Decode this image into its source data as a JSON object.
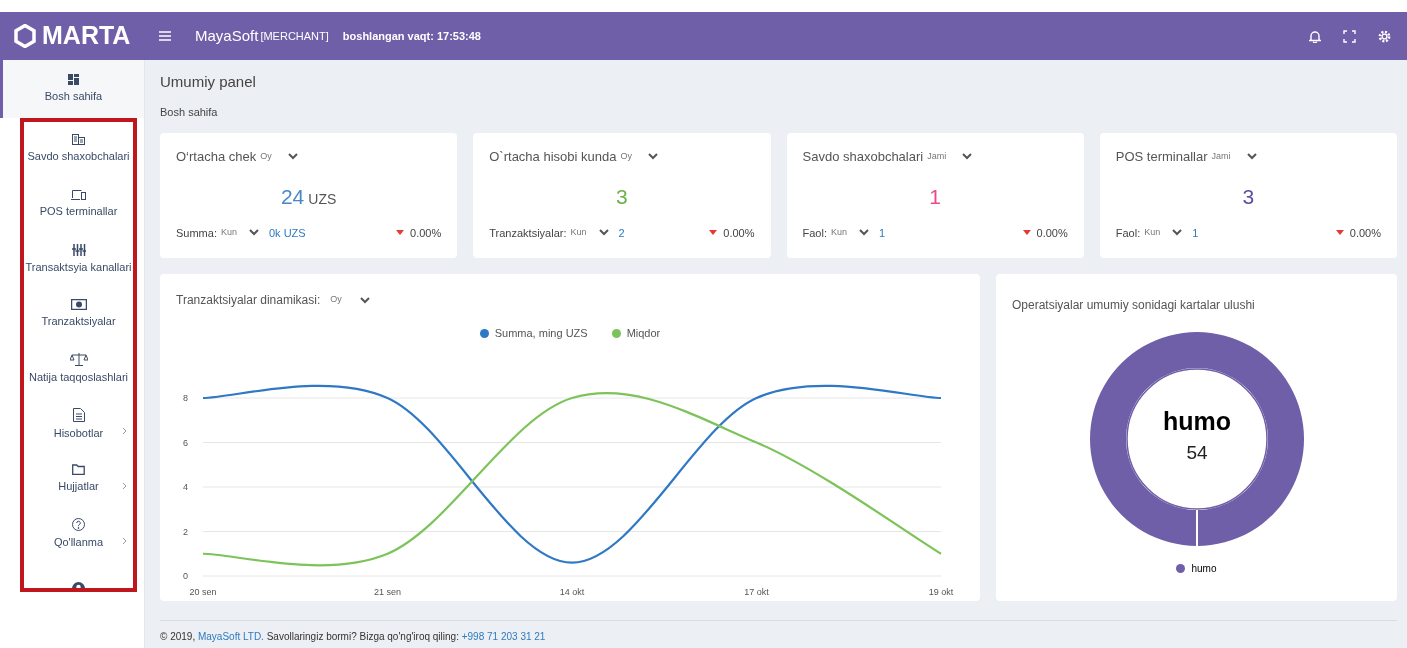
{
  "navbar": {
    "logo": "MARTA",
    "app": "MayaSoft",
    "role": "[MERCHANT]",
    "session": "boshlangan vaqt: 17:53:48"
  },
  "sidebar": {
    "items": [
      {
        "kind": "dashboard",
        "label": "Bosh sahifa",
        "selected": true,
        "has_submenu": false
      },
      {
        "kind": "building",
        "label": "Savdo shaxobchalari",
        "selected": false,
        "has_submenu": false
      },
      {
        "kind": "devices",
        "label": "POS terminallar",
        "selected": false,
        "has_submenu": false
      },
      {
        "kind": "sliders",
        "label": "Transaktsyia kanallari",
        "selected": false,
        "has_submenu": false
      },
      {
        "kind": "money",
        "label": "Tranzaktsiyalar",
        "selected": false,
        "has_submenu": false
      },
      {
        "kind": "scales",
        "label": "Natija taqqoslashlari",
        "selected": false,
        "has_submenu": false
      },
      {
        "kind": "document",
        "label": "Hisobotlar",
        "selected": false,
        "has_submenu": true
      },
      {
        "kind": "folder",
        "label": "Hujjatlar",
        "selected": false,
        "has_submenu": true
      },
      {
        "kind": "help",
        "label": "Qo'llanma",
        "selected": false,
        "has_submenu": true
      },
      {
        "kind": "user",
        "selected": false,
        "has_submenu": false
      }
    ]
  },
  "page": {
    "title": "Umumiy panel",
    "breadcrumb": "Bosh sahifa"
  },
  "stat_cards": [
    {
      "title": "O‘rtacha chek",
      "period": "Oy",
      "value": "24",
      "unit": "UZS",
      "color": "#4a86c8",
      "footer_label": "Summa:",
      "footer_period": "Kun",
      "footer_value": "0k UZS",
      "change": "0.00%",
      "falling": true
    },
    {
      "title": "O`rtacha hisobi kunda",
      "period": "Oy",
      "value": "3",
      "color": "#6ab04c",
      "footer_label": "Tranzaktsiyalar:",
      "footer_period": "Kun",
      "footer_value": "2",
      "change": "0.00%",
      "falling": true
    },
    {
      "title": "Savdo shaxobchalari",
      "period": "Jami",
      "value": "1",
      "color": "#ea4c89",
      "footer_label": "Faol:",
      "footer_period": "Kun",
      "footer_value": "1",
      "change": "0.00%",
      "falling": true
    },
    {
      "title": "POS terminallar",
      "period": "Jami",
      "value": "3",
      "color": "#5b4ea0",
      "footer_label": "Faol:",
      "footer_period": "Kun",
      "footer_value": "1",
      "change": "0.00%",
      "falling": true
    }
  ],
  "chart_panel": {
    "title": "Tranzaktsiyalar dinamikasi:",
    "period": "Oy",
    "chart_data": {
      "type": "line",
      "categories": [
        "20 sen",
        "21 sen",
        "14 okt",
        "17 okt",
        "19 okt"
      ],
      "series": [
        {
          "name": "Summa, ming UZS",
          "color": "#2f78c4",
          "values": [
            8,
            8,
            0.6,
            8,
            8
          ]
        },
        {
          "name": "Miqdor",
          "color": "#7cc35a",
          "values": [
            1,
            1,
            8,
            6,
            1
          ]
        }
      ],
      "ylim": [
        0,
        8
      ],
      "yticks": [
        0,
        2,
        4,
        6,
        8
      ],
      "grid": true
    }
  },
  "donut_panel": {
    "title": "Operatsiyalar umumiy sonidagi kartalar ulushi",
    "center_label": "humo",
    "center_value": "54",
    "legend": [
      {
        "label": "humo",
        "color": "#6f5fa8"
      }
    ]
  },
  "footer": {
    "copyright": "© 2019,",
    "company": "MayaSoft LTD.",
    "question": "Savollaringiz bormi? Bizga qo'ng'iroq qiling:",
    "phone": "+998 71 203 31 21"
  }
}
